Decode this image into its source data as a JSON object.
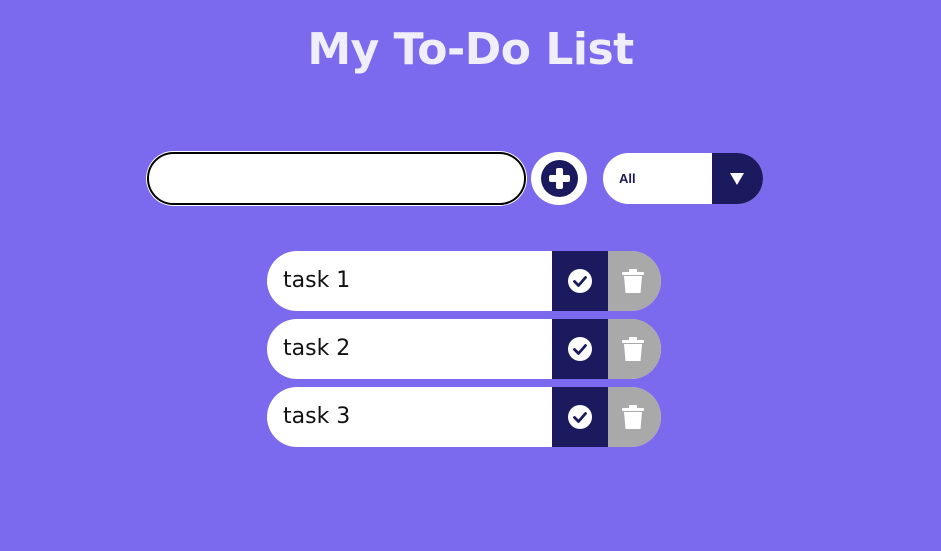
{
  "header": {
    "title": "My To-Do List"
  },
  "form": {
    "input_value": "",
    "add_icon": "plus-circle-icon",
    "filter": {
      "selected": "All",
      "arrow_icon": "triangle-down-icon"
    }
  },
  "todos": [
    {
      "text": "task 1",
      "complete_icon": "check-circle-icon",
      "delete_icon": "trash-icon"
    },
    {
      "text": "task 2",
      "complete_icon": "check-circle-icon",
      "delete_icon": "trash-icon"
    },
    {
      "text": "task 3",
      "complete_icon": "check-circle-icon",
      "delete_icon": "trash-icon"
    }
  ],
  "colors": {
    "background": "#7b69ee",
    "accent_dark": "#1b1a5e",
    "trash_gray": "#a9a9a9",
    "title_text": "#f1eefc"
  }
}
